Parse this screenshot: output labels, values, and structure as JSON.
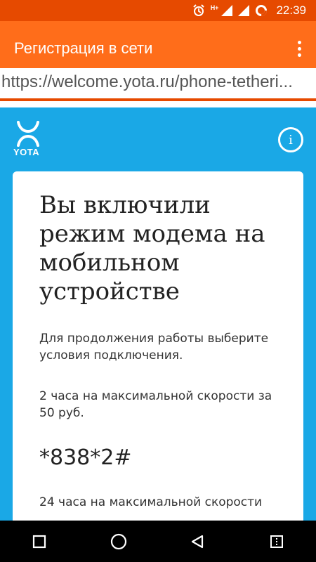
{
  "status_bar": {
    "time": "22:39",
    "network_label": "H+",
    "icons": [
      "alarm-icon",
      "signal-icon",
      "signal-icon",
      "sync-icon"
    ]
  },
  "app_bar": {
    "title": "Регистрация в сети",
    "menu_icon": "more-vert-icon"
  },
  "url_bar": {
    "url": "https://welcome.yota.ru/phone-tetheri..."
  },
  "page": {
    "logo_text": "YOTA",
    "info_label": "i",
    "heading": "Вы включили режим модема на мобильном устройстве",
    "intro": "Для продолжения работы выберите условия подключения.",
    "offer1": "2 часа на максимальной скорости за 50 руб.",
    "offer1_code": "*838*2#",
    "offer2": "24 часа на максимальной скорости"
  },
  "colors": {
    "status_bar": "#e64a00",
    "app_bar": "#ff6d1a",
    "page_background": "#1aa8e6",
    "card": "#ffffff"
  },
  "nav_bar": {
    "icons": [
      "recent-apps-icon",
      "home-icon",
      "back-icon",
      "menu-icon"
    ]
  }
}
